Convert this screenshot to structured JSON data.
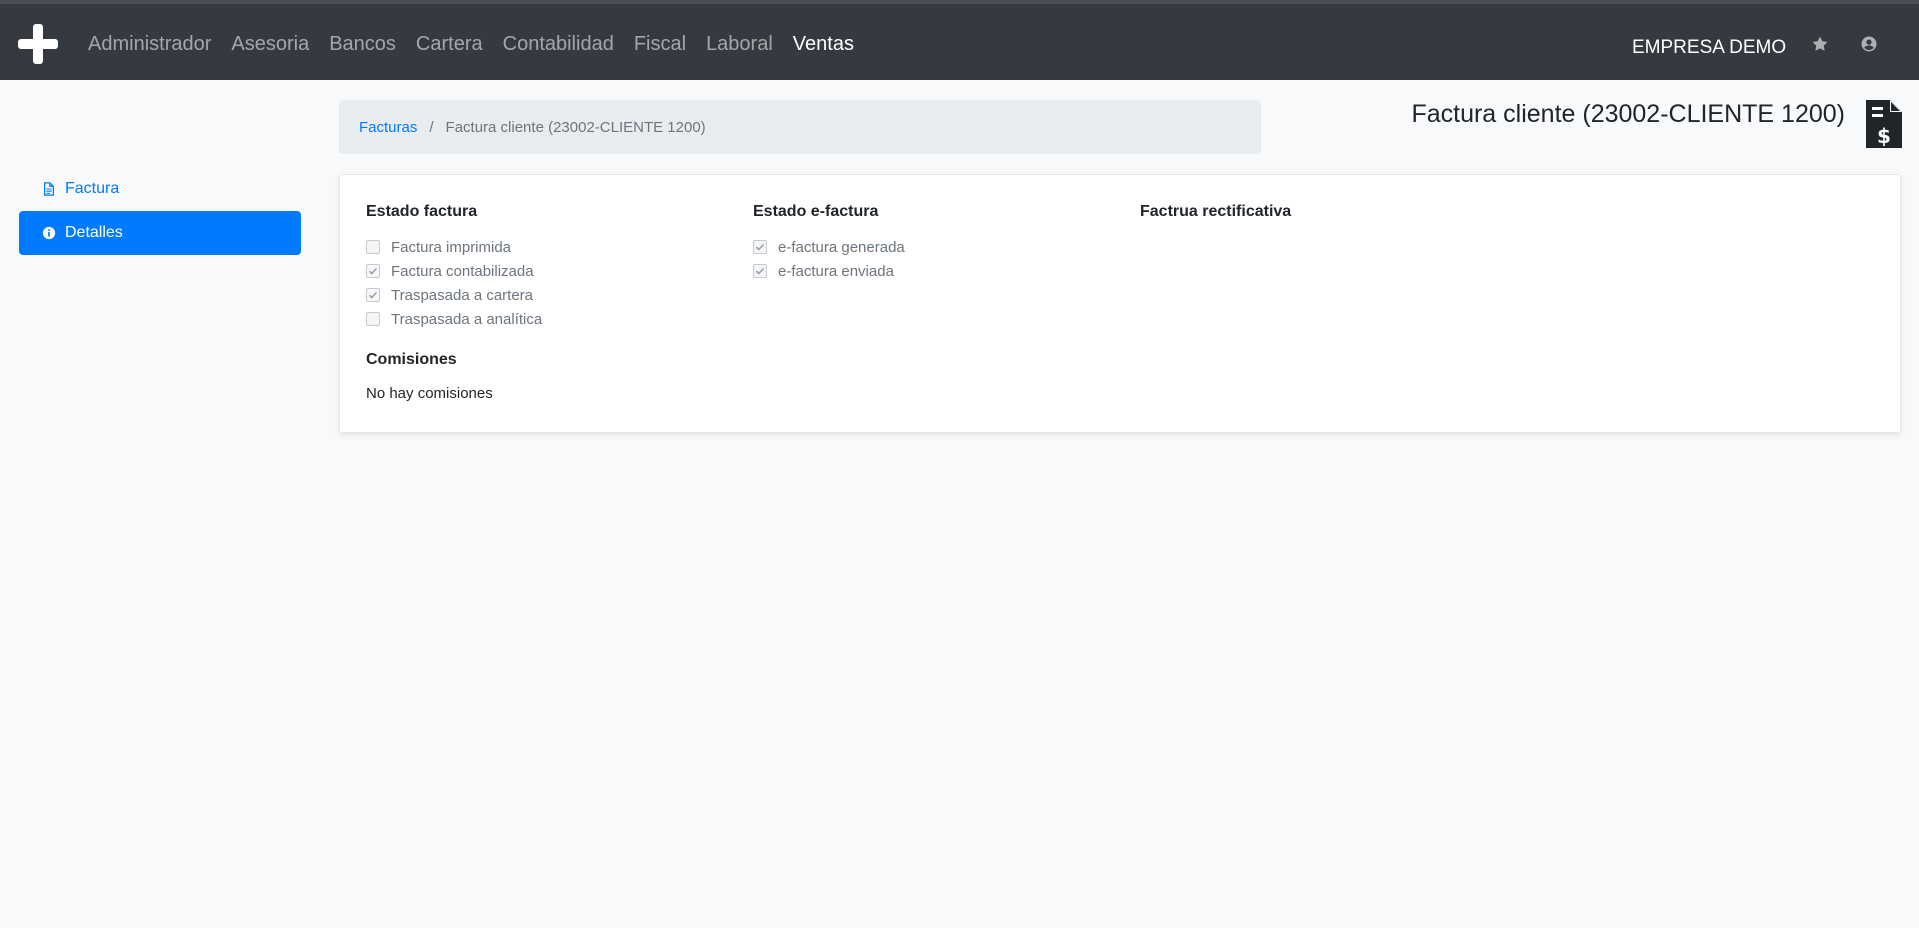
{
  "nav": {
    "items": [
      {
        "label": "Administrador",
        "active": false
      },
      {
        "label": "Asesoria",
        "active": false
      },
      {
        "label": "Bancos",
        "active": false
      },
      {
        "label": "Cartera",
        "active": false
      },
      {
        "label": "Contabilidad",
        "active": false
      },
      {
        "label": "Fiscal",
        "active": false
      },
      {
        "label": "Laboral",
        "active": false
      },
      {
        "label": "Ventas",
        "active": true
      }
    ],
    "company": "EMPRESA DEMO",
    "icons": [
      "star-icon",
      "user-circle-icon"
    ]
  },
  "sidebar": {
    "items": [
      {
        "label": "Factura",
        "icon": "file-text-icon",
        "active": false
      },
      {
        "label": "Detalles",
        "icon": "info-circle-icon",
        "active": true
      }
    ]
  },
  "breadcrumb": {
    "link": "Facturas",
    "separator": "/",
    "current": "Factura cliente (23002-CLIENTE 1200)"
  },
  "page": {
    "title": "Factura cliente (23002-CLIENTE 1200)",
    "icon": "file-invoice-dollar-icon"
  },
  "details": {
    "estado_factura": {
      "heading": "Estado factura",
      "items": [
        {
          "label": "Factura imprimida",
          "checked": false
        },
        {
          "label": "Factura contabilizada",
          "checked": true
        },
        {
          "label": "Traspasada a cartera",
          "checked": true
        },
        {
          "label": "Traspasada a analítica",
          "checked": false
        }
      ]
    },
    "estado_efactura": {
      "heading": "Estado e-factura",
      "items": [
        {
          "label": "e-factura generada",
          "checked": true
        },
        {
          "label": "e-factura enviada",
          "checked": true
        }
      ]
    },
    "rectificativa": {
      "heading": "Factrua rectificativa"
    },
    "comisiones": {
      "heading": "Comisiones",
      "empty_text": "No hay comisiones"
    }
  },
  "colors": {
    "navbar": "#343a40",
    "primary": "#007bff",
    "background": "#f8f9fa"
  }
}
